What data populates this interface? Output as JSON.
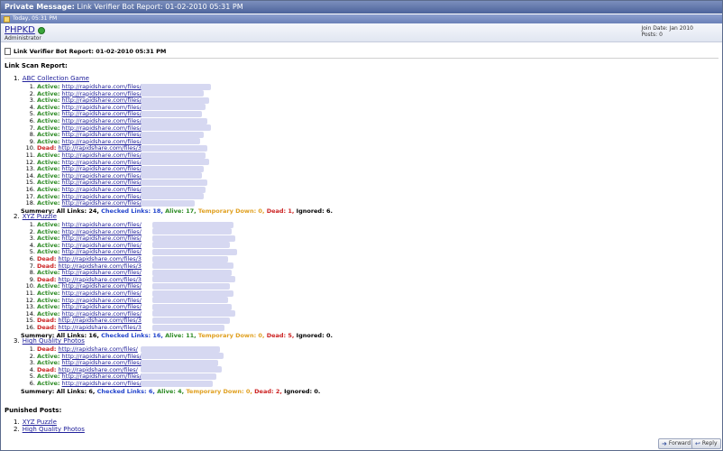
{
  "window": {
    "title_prefix": "Private Message:",
    "title_rest": "Link Verifier Bot Report: 01-02-2010 05:31 PM"
  },
  "date_bar": {
    "text": "Today, 05:31 PM",
    "icon": "post-icon"
  },
  "user": {
    "name": "PHPKD",
    "title": "Administrator",
    "join_date": "Join Date: Jan 2010",
    "posts": "Posts: 0",
    "status_icon": "online-dot"
  },
  "message": {
    "title": "Link Verifier Bot Report: 01-02-2010 05:31 PM",
    "report_heading": "Link Scan Report:"
  },
  "groups": [
    {
      "num": "1.",
      "title": "ABC Collection Game",
      "links": [
        {
          "n": "1.",
          "status": "Active:",
          "url": "http://rapidshare.com/files/"
        },
        {
          "n": "2.",
          "status": "Active:",
          "url": "http://rapidshare.com/files/"
        },
        {
          "n": "3.",
          "status": "Active:",
          "url": "http://rapidshare.com/files/"
        },
        {
          "n": "4.",
          "status": "Active:",
          "url": "http://rapidshare.com/files/"
        },
        {
          "n": "5.",
          "status": "Active:",
          "url": "http://rapidshare.com/files/"
        },
        {
          "n": "6.",
          "status": "Active:",
          "url": "http://rapidshare.com/files/"
        },
        {
          "n": "7.",
          "status": "Active:",
          "url": "http://rapidshare.com/files/"
        },
        {
          "n": "8.",
          "status": "Active:",
          "url": "http://rapidshare.com/files/"
        },
        {
          "n": "9.",
          "status": "Active:",
          "url": "http://rapidshare.com/files/"
        },
        {
          "n": "10.",
          "status": "Dead:",
          "url": "http://rapidshare.com/files/3"
        },
        {
          "n": "11.",
          "status": "Active:",
          "url": "http://rapidshare.com/files/"
        },
        {
          "n": "12.",
          "status": "Active:",
          "url": "http://rapidshare.com/files/"
        },
        {
          "n": "13.",
          "status": "Active:",
          "url": "http://rapidshare.com/files/"
        },
        {
          "n": "14.",
          "status": "Active:",
          "url": "http://rapidshare.com/files/"
        },
        {
          "n": "15.",
          "status": "Active:",
          "url": "http://rapidshare.com/files/"
        },
        {
          "n": "16.",
          "status": "Active:",
          "url": "http://rapidshare.com/files/"
        },
        {
          "n": "17.",
          "status": "Active:",
          "url": "http://rapidshare.com/files/"
        },
        {
          "n": "18.",
          "status": "Active:",
          "url": "http://rapidshare.com/files/"
        }
      ],
      "summary": {
        "label": "Summery: All Links: 24,",
        "checked": "Checked Links: 18,",
        "alive": "Alive: 17,",
        "temp": "Temporary Down: 0,",
        "dead": "Dead: 1,",
        "ignored": "Ignored: 6."
      }
    },
    {
      "num": "2.",
      "title": "XYZ Puzzle",
      "links": [
        {
          "n": "1.",
          "status": "Active:",
          "url": "http://rapidshare.com/files/"
        },
        {
          "n": "2.",
          "status": "Active:",
          "url": "http://rapidshare.com/files/"
        },
        {
          "n": "3.",
          "status": "Active:",
          "url": "http://rapidshare.com/files/"
        },
        {
          "n": "4.",
          "status": "Active:",
          "url": "http://rapidshare.com/files/"
        },
        {
          "n": "5.",
          "status": "Active:",
          "url": "http://rapidshare.com/files/"
        },
        {
          "n": "6.",
          "status": "Dead:",
          "url": "http://rapidshare.com/files/3"
        },
        {
          "n": "7.",
          "status": "Dead:",
          "url": "http://rapidshare.com/files/3"
        },
        {
          "n": "8.",
          "status": "Active:",
          "url": "http://rapidshare.com/files/"
        },
        {
          "n": "9.",
          "status": "Dead:",
          "url": "http://rapidshare.com/files/3"
        },
        {
          "n": "10.",
          "status": "Active:",
          "url": "http://rapidshare.com/files/"
        },
        {
          "n": "11.",
          "status": "Active:",
          "url": "http://rapidshare.com/files/"
        },
        {
          "n": "12.",
          "status": "Active:",
          "url": "http://rapidshare.com/files/"
        },
        {
          "n": "13.",
          "status": "Active:",
          "url": "http://rapidshare.com/files/"
        },
        {
          "n": "14.",
          "status": "Active:",
          "url": "http://rapidshare.com/files/"
        },
        {
          "n": "15.",
          "status": "Dead:",
          "url": "http://rapidshare.com/files/3"
        },
        {
          "n": "16.",
          "status": "Dead:",
          "url": "http://rapidshare.com/files/3"
        }
      ],
      "summary": {
        "label": "Summery: All Links: 16,",
        "checked": "Checked Links: 16,",
        "alive": "Alive: 11,",
        "temp": "Temporary Down: 0,",
        "dead": "Dead: 5,",
        "ignored": "Ignored: 0."
      }
    },
    {
      "num": "3.",
      "title": "High Quality Photos",
      "links": [
        {
          "n": "1.",
          "status": "Dead:",
          "url": "http://rapidshare.com/files/"
        },
        {
          "n": "2.",
          "status": "Active:",
          "url": "http://rapidshare.com/files/"
        },
        {
          "n": "3.",
          "status": "Active:",
          "url": "http://rapidshare.com/files/"
        },
        {
          "n": "4.",
          "status": "Dead:",
          "url": "http://rapidshare.com/files/"
        },
        {
          "n": "5.",
          "status": "Active:",
          "url": "http://rapidshare.com/files/"
        },
        {
          "n": "6.",
          "status": "Active:",
          "url": "http://rapidshare.com/files/"
        }
      ],
      "summary": {
        "label": "Summery: All Links: 6,",
        "checked": "Checked Links: 6,",
        "alive": "Alive: 4,",
        "temp": "Temporary Down: 0,",
        "dead": "Dead: 2,",
        "ignored": "Ignored: 0."
      }
    }
  ],
  "punished": {
    "heading": "Punished Posts:",
    "items": [
      {
        "n": "1.",
        "title": "XYZ Puzzle"
      },
      {
        "n": "2.",
        "title": "High Quality Photos"
      }
    ]
  },
  "buttons": {
    "forward": "Forward",
    "reply": "Reply",
    "forward_icon": "forward-icon",
    "reply_icon": "reply-icon"
  },
  "colors": {
    "active": "#2c8a24",
    "dead": "#cc2222",
    "checked": "#2244cc",
    "temp": "#e0a020",
    "link": "#22229c",
    "titlebar": "#4c639b"
  }
}
